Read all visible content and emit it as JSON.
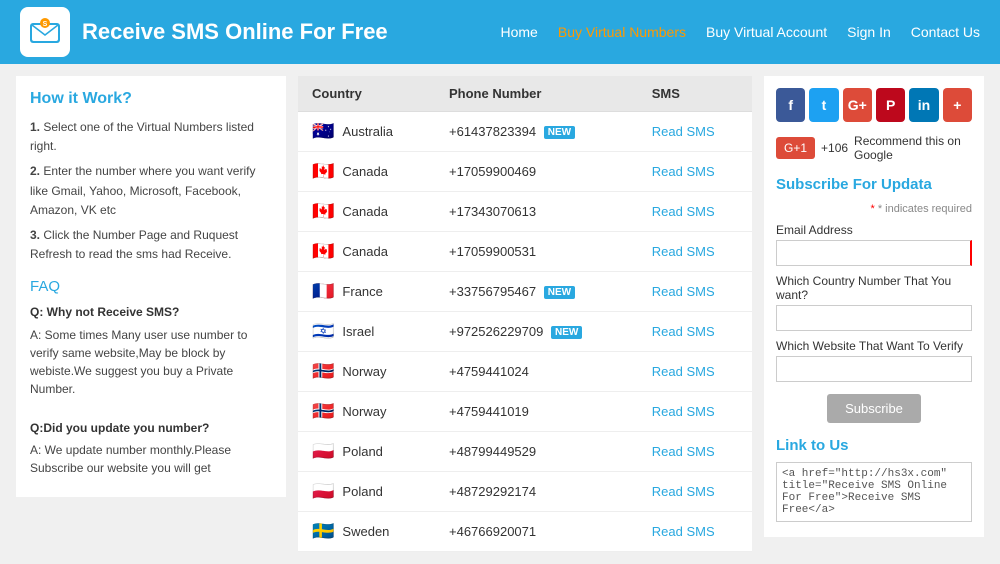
{
  "header": {
    "site_title": "Receive SMS Online For Free",
    "nav": [
      {
        "label": "Home",
        "style": "normal"
      },
      {
        "label": "Buy Virtual Numbers",
        "style": "orange"
      },
      {
        "label": "Buy Virtual Account",
        "style": "normal"
      },
      {
        "label": "Sign In",
        "style": "normal"
      },
      {
        "label": "Contact Us",
        "style": "normal"
      }
    ]
  },
  "left": {
    "how_title": "How it Work?",
    "step1": "Select one of the Virtual Numbers listed right.",
    "step2": "Enter the number where you want verify like Gmail, Yahoo, Microsoft, Facebook, Amazon, VK etc",
    "step3": "Click the Number Page and Ruquest Refresh to read the sms had Receive.",
    "faq_title": "FAQ",
    "q1": "Q: Why not Receive SMS?",
    "a1": "A: Some times Many user use number to verify same website,May be block by webiste.We suggest you buy a Private Number.",
    "q2": "Q:Did you update you number?",
    "a2": "A: We update number monthly.Please Subscribe our website you will get"
  },
  "table": {
    "headers": [
      "Country",
      "Phone Number",
      "SMS"
    ],
    "rows": [
      {
        "flag": "🇦🇺",
        "country": "Australia",
        "phone": "+61437823394",
        "new": true,
        "sms": "Read SMS"
      },
      {
        "flag": "🇨🇦",
        "country": "Canada",
        "phone": "+17059900469",
        "new": false,
        "sms": "Read SMS"
      },
      {
        "flag": "🇨🇦",
        "country": "Canada",
        "phone": "+17343070613",
        "new": false,
        "sms": "Read SMS"
      },
      {
        "flag": "🇨🇦",
        "country": "Canada",
        "phone": "+17059900531",
        "new": false,
        "sms": "Read SMS"
      },
      {
        "flag": "🇫🇷",
        "country": "France",
        "phone": "+33756795467",
        "new": true,
        "sms": "Read SMS"
      },
      {
        "flag": "🇮🇱",
        "country": "Israel",
        "phone": "+972526229709",
        "new": true,
        "sms": "Read SMS"
      },
      {
        "flag": "🇳🇴",
        "country": "Norway",
        "phone": "+4759441024",
        "new": false,
        "sms": "Read SMS"
      },
      {
        "flag": "🇳🇴",
        "country": "Norway",
        "phone": "+4759441019",
        "new": false,
        "sms": "Read SMS"
      },
      {
        "flag": "🇵🇱",
        "country": "Poland",
        "phone": "+48799449529",
        "new": false,
        "sms": "Read SMS"
      },
      {
        "flag": "🇵🇱",
        "country": "Poland",
        "phone": "+48729292174",
        "new": false,
        "sms": "Read SMS"
      },
      {
        "flag": "🇸🇪",
        "country": "Sweden",
        "phone": "+46766920071",
        "new": false,
        "sms": "Read SMS"
      }
    ]
  },
  "right": {
    "social": [
      {
        "label": "f",
        "class": "fb",
        "name": "facebook"
      },
      {
        "label": "t",
        "class": "tw",
        "name": "twitter"
      },
      {
        "label": "G+",
        "class": "gp",
        "name": "googleplus"
      },
      {
        "label": "P",
        "class": "pt",
        "name": "pinterest"
      },
      {
        "label": "in",
        "class": "li",
        "name": "linkedin"
      },
      {
        "label": "+",
        "class": "pl",
        "name": "plus"
      }
    ],
    "gplus_label": "G+1",
    "gplus_count": "+106",
    "gplus_text": "Recommend this on Google",
    "subscribe_title": "Subscribe For Updata",
    "required_note": "* indicates required",
    "email_label": "Email Address",
    "country_label": "Which Country Number That You want?",
    "website_label": "Which Website That Want To Verify",
    "subscribe_btn": "Subscribe",
    "link_title": "Link to Us",
    "link_code": "<a href=\"http://hs3x.com\" title=\"Receive SMS Online For Free\">Receive SMS Free</a>"
  }
}
